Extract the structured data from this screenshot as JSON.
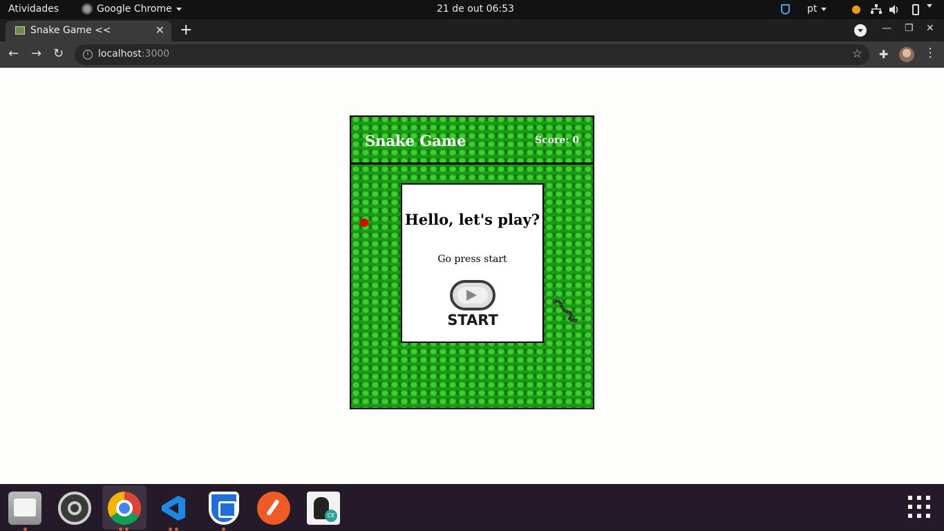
{
  "topbar": {
    "activities": "Atividades",
    "app_name": "Google Chrome",
    "clock": "21 de out  06:53",
    "language": "pt"
  },
  "browser": {
    "tab_title": "Snake Game <<",
    "url_host": "localhost",
    "url_port": ":3000"
  },
  "game": {
    "title": "Snake Game",
    "score_label": "Score: 0",
    "modal_title": "Hello, let's play?",
    "modal_subtitle": "Go press start",
    "start_label": "START",
    "food_color": "#e10000",
    "board_color": "#1a9a14"
  },
  "dock": {
    "items": [
      "files-icon",
      "settings-icon",
      "chrome-icon",
      "vscode-icon",
      "shield-app-icon",
      "postman-icon",
      "ce-icon",
      "show-apps-icon"
    ]
  }
}
